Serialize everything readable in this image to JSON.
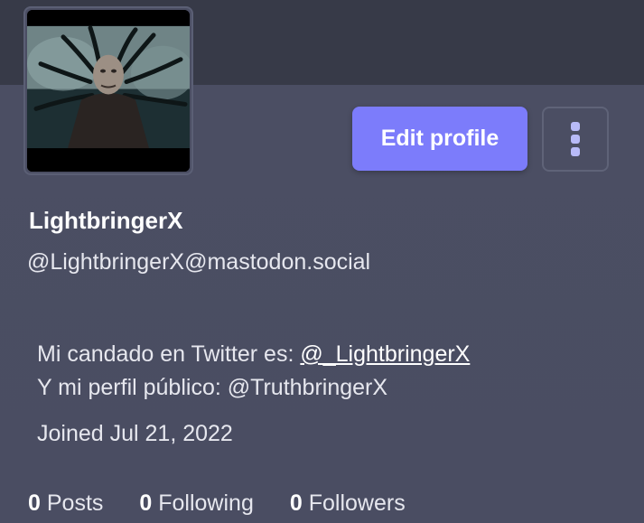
{
  "profile": {
    "display_name": "LightbringerX",
    "handle": "@LightbringerX@mastodon.social",
    "bio_line1_prefix": "Mi candado en Twitter es: ",
    "bio_line1_link": "@_LightbringerX",
    "bio_line2": "Y mi perfil público: @TruthbringerX",
    "joined": "Joined Jul 21, 2022"
  },
  "actions": {
    "edit_label": "Edit profile",
    "menu_icon": "vertical-ellipsis-icon"
  },
  "stats": [
    {
      "count": "0",
      "label": "Posts"
    },
    {
      "count": "0",
      "label": "Following"
    },
    {
      "count": "0",
      "label": "Followers"
    }
  ],
  "colors": {
    "accent": "#7c7cfb",
    "banner": "#373a48",
    "background": "#4a4d62",
    "menu_dots": "#b8baf8"
  }
}
